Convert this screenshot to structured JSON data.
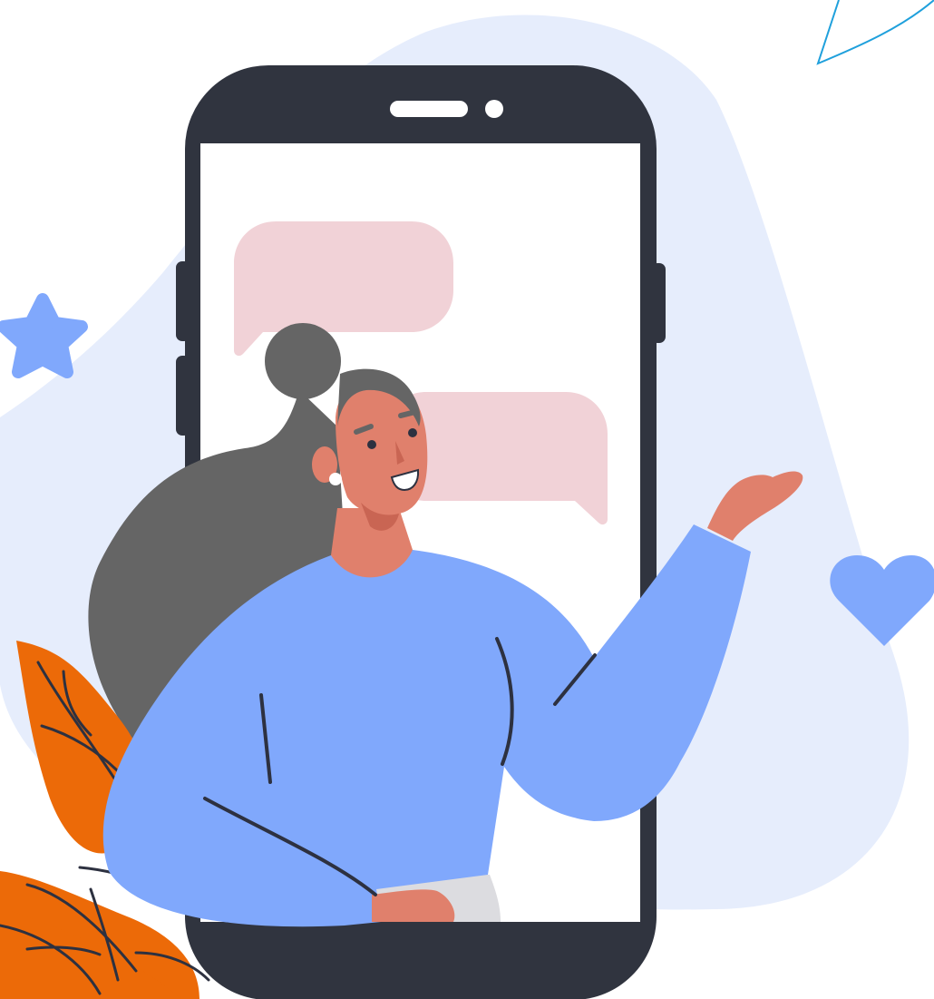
{
  "illustration": {
    "colors": {
      "background": "#ffffff",
      "blob": "#e6edfc",
      "phone_body": "#30343f",
      "screen": "#ffffff",
      "chat_bubble": "#f1d2d7",
      "hair": "#656565",
      "skin": "#e0806c",
      "sweater": "#80a8fc",
      "outline": "#2d3140",
      "leaf": "#ec6a08",
      "star": "#80a8fc",
      "heart": "#80a8fc",
      "sparkle_stroke": "#1fa0dc",
      "earring": "#ffffff",
      "pants": "#dcdce0"
    },
    "icons": [
      "star-icon",
      "heart-icon",
      "sparkle-icon",
      "leaf-icon"
    ]
  }
}
